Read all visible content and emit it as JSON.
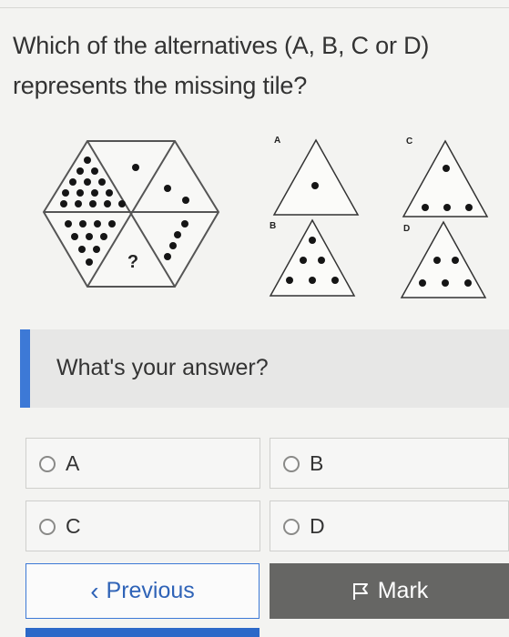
{
  "question": {
    "line1": "Which of the alternatives (A, B, C or D)",
    "line2": "represents the missing tile?"
  },
  "puzzle": {
    "missing_mark": "?",
    "choice_labels": [
      "A",
      "B",
      "C",
      "D"
    ]
  },
  "answer": {
    "prompt": "What's your answer?",
    "options": [
      "A",
      "B",
      "C",
      "D"
    ]
  },
  "nav": {
    "previous_icon": "‹",
    "previous_label": "Previous",
    "mark_icon": "flag-icon",
    "mark_label": "Mark"
  },
  "colors": {
    "accent": "#3d79d6",
    "mark_button": "#666664"
  }
}
